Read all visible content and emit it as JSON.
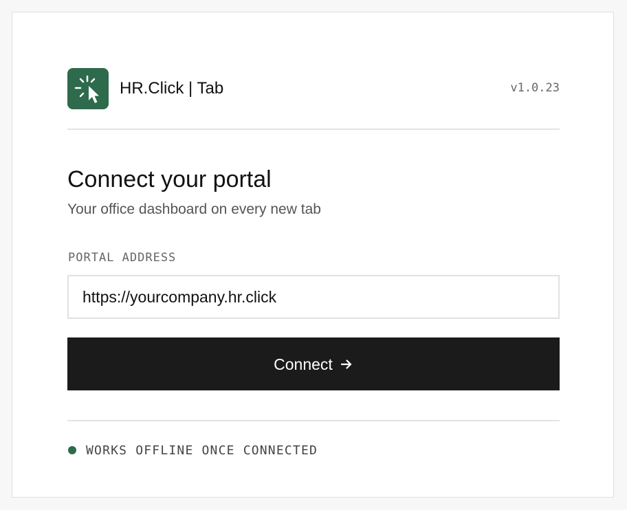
{
  "app": {
    "logo_icon": "click-cursor-icon",
    "title": "HR.Click | Tab",
    "version": "v1.0.23",
    "brand_color": "#2e6a4c"
  },
  "connect": {
    "heading": "Connect your portal",
    "subheading": "Your office dashboard on every new tab",
    "field_label": "PORTAL ADDRESS",
    "input_placeholder": "https://yourcompany.hr.click",
    "input_value": "",
    "button_label": "Connect",
    "button_icon": "arrow-right-icon",
    "button_color": "#1b1b1c"
  },
  "status": {
    "indicator_icon": "status-dot-icon",
    "text": "WORKS OFFLINE ONCE CONNECTED"
  }
}
